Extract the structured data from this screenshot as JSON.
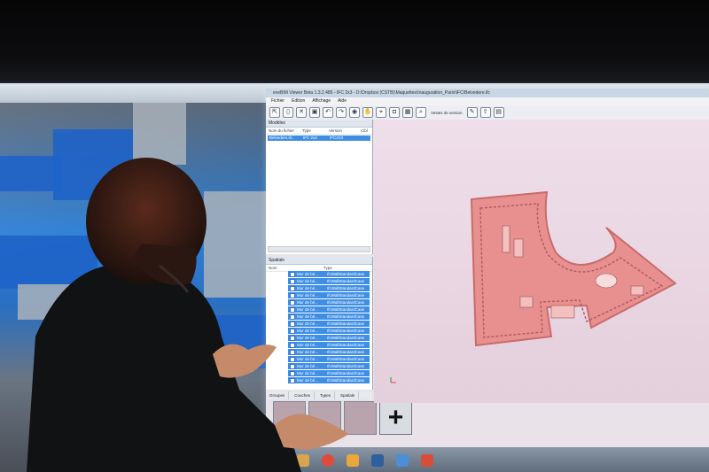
{
  "app": {
    "title": "eveBIM Viewer Beta 1.3.2.485 - IFC 2x3 - D:\\Dropbox (CSTB)\\Maquettes\\Inauguration_Paris\\IFC\\Belvedere.ifc",
    "menu": [
      "Fichier",
      "Edition",
      "Affichage",
      "Aide"
    ],
    "toolbar_label": "Vestes de version",
    "icons": [
      "select-icon",
      "document-icon",
      "close-icon",
      "save-icon",
      "undo-icon",
      "redo-icon",
      "eye-icon",
      "hand-icon",
      "pin-icon",
      "camera-icon",
      "search-icon",
      "pencil-icon",
      "grid-icon",
      "share-icon",
      "layout-icon"
    ]
  },
  "models_panel": {
    "header": "Modèles",
    "columns": [
      "Nom du fichier",
      "Type",
      "Version",
      "Cibl"
    ],
    "rows": [
      {
        "name": "Belvedere.ifc",
        "type": "IFC 2x3",
        "version": "IFC2X3"
      }
    ]
  },
  "spatial_panel": {
    "header": "Spatiale",
    "columns": [
      "Nom",
      "Type"
    ],
    "items": [
      {
        "name": "Mur de bé...",
        "type": "IfcWallStandardCase"
      },
      {
        "name": "Mur de bé...",
        "type": "IfcWallStandardCase"
      },
      {
        "name": "Mur de bé...",
        "type": "IfcWallStandardCase"
      },
      {
        "name": "Mur de bé...",
        "type": "IfcWallStandardCase"
      },
      {
        "name": "Mur de bé...",
        "type": "IfcWallStandardCase"
      },
      {
        "name": "Mur de bé...",
        "type": "IfcWallStandardCase"
      },
      {
        "name": "Mur de bé...",
        "type": "IfcWallStandardCase"
      },
      {
        "name": "Mur de bé...",
        "type": "IfcWallStandardCase"
      },
      {
        "name": "Mur de bé...",
        "type": "IfcWallStandardCase"
      },
      {
        "name": "Mur de bé...",
        "type": "IfcWallStandardCase"
      },
      {
        "name": "Mur de bé...",
        "type": "IfcWallStandardCase"
      },
      {
        "name": "Mur de bé...",
        "type": "IfcWallStandardCase"
      },
      {
        "name": "Mur de bé...",
        "type": "IfcWallStandardCase"
      },
      {
        "name": "Mur de bé...",
        "type": "IfcWallStandardCase"
      },
      {
        "name": "Mur de bé...",
        "type": "IfcWallStandardCase"
      },
      {
        "name": "Mur de bé...",
        "type": "IfcWallStandardCase"
      }
    ]
  },
  "tabs": [
    "Groupes",
    "Couches",
    "Types",
    "Spatiale"
  ],
  "thumbnail_add_label": "+",
  "colors": {
    "selection": "#3f8ee6",
    "building": "#e8908f",
    "viewport_bg": "#e8d6e1"
  }
}
